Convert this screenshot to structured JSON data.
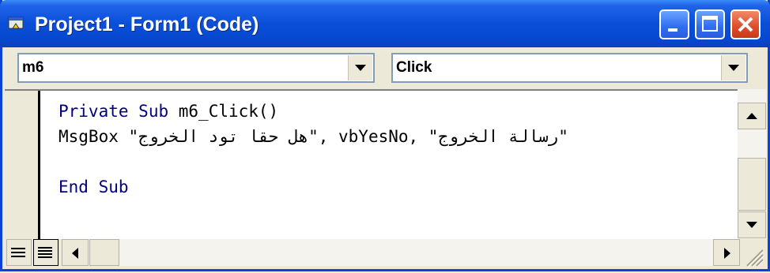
{
  "window": {
    "title": "Project1 - Form1 (Code)"
  },
  "object_combo": {
    "value": "m6"
  },
  "procedure_combo": {
    "value": "Click"
  },
  "code": {
    "line1_kw1": "Private",
    "line1_kw2": "Sub",
    "line1_rest": "m6_Click()",
    "line2": "MsgBox \"هل حقا تود الخروج\", vbYesNo, \"رسالة الخروج\"",
    "line3_kw1": "End",
    "line3_kw2": "Sub"
  },
  "colors": {
    "titlebar": "#0a4fd8",
    "keyword": "#00007f",
    "close_button": "#dd4b2a"
  },
  "icons": [
    "app-icon",
    "minimize-icon",
    "maximize-icon",
    "close-icon",
    "dropdown-arrow-icon",
    "scroll-up-icon",
    "scroll-down-icon",
    "scroll-left-icon",
    "scroll-right-icon",
    "procedure-view-icon",
    "full-module-view-icon",
    "resize-grip-icon"
  ]
}
